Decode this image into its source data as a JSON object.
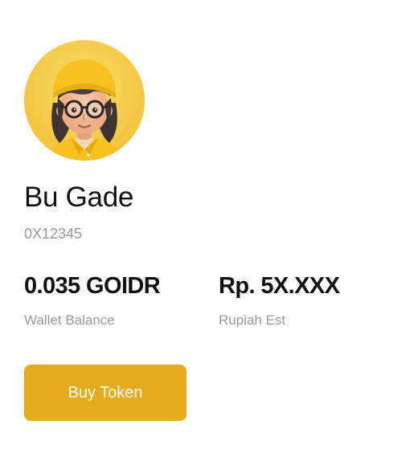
{
  "profile": {
    "name": "Bu Gade",
    "address": "0X12345",
    "avatar_icon": "user-avatar-illustration"
  },
  "stats": {
    "wallet_balance_value": "0.035 GOIDR",
    "wallet_balance_label": "Wallet Balance",
    "rupiah_value": "Rp. 5X.XXX",
    "rupiah_label": "Rupiah Est"
  },
  "actions": {
    "buy_label": "Buy Token"
  },
  "colors": {
    "accent": "#e4ac1a",
    "avatar_bg": "#f6c945",
    "muted_text": "#9a9a9a",
    "text": "#111111"
  }
}
